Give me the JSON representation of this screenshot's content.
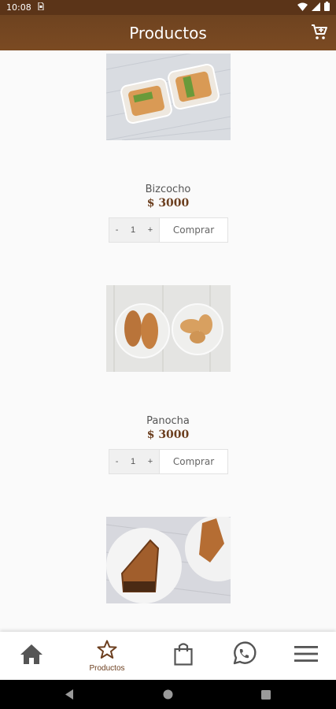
{
  "status": {
    "time": "10:08",
    "sim_icon": "sim-card-icon"
  },
  "header": {
    "title": "Productos",
    "cart_icon": "cart-icon"
  },
  "products": [
    {
      "name": "",
      "price": "",
      "quantity": "1",
      "buy_label": "Comprar"
    },
    {
      "name": "Bizcocho",
      "price": "$ 3000",
      "quantity": "1",
      "buy_label": "Comprar"
    },
    {
      "name": "Panocha",
      "price": "$ 3000",
      "quantity": "1",
      "buy_label": "Comprar"
    }
  ],
  "stepper": {
    "minus": "-",
    "plus": "+"
  },
  "bottom_nav": {
    "items": [
      {
        "icon": "home-icon",
        "label": ""
      },
      {
        "icon": "star-icon",
        "label": "Productos",
        "active": true
      },
      {
        "icon": "shopping-bag-icon",
        "label": ""
      },
      {
        "icon": "whatsapp-icon",
        "label": ""
      },
      {
        "icon": "menu-icon",
        "label": ""
      }
    ]
  },
  "colors": {
    "brand": "#7b4a22",
    "price": "#6b3e1e",
    "status_bar": "#5b3418"
  }
}
